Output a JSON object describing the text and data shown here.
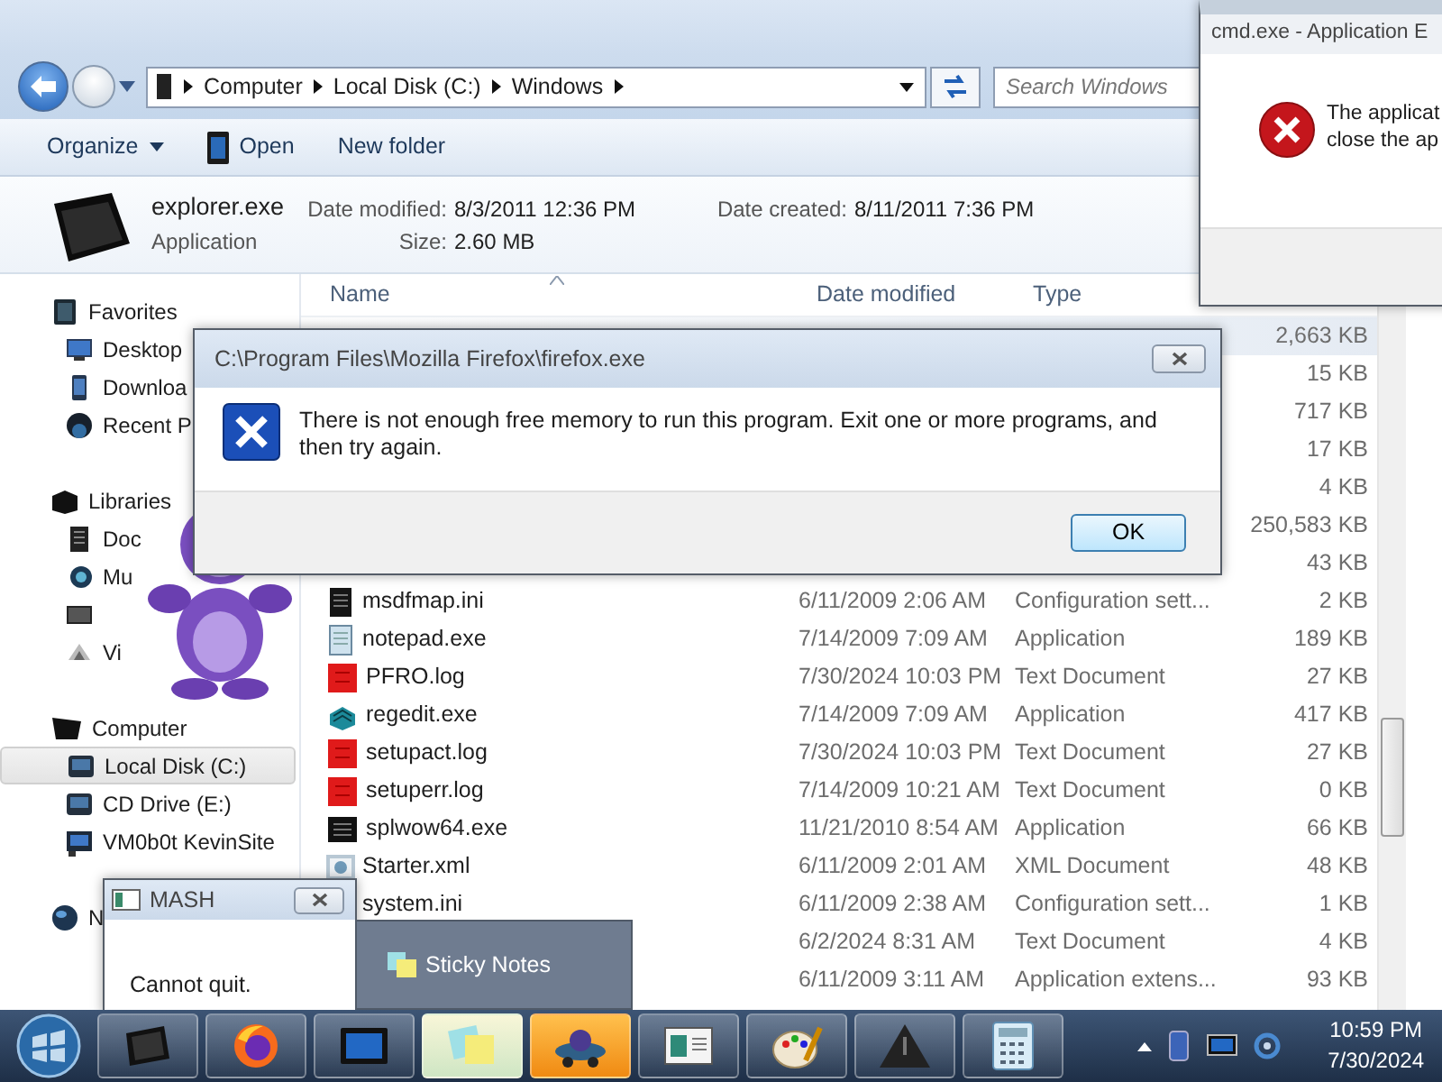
{
  "explorer": {
    "address": {
      "crumbs": [
        "Computer",
        "Local Disk (C:)",
        "Windows"
      ]
    },
    "search": {
      "placeholder": "Search Windows"
    },
    "toolbar": [
      {
        "label": "Organize",
        "kind": "menu"
      },
      {
        "label": "Open",
        "kind": "open"
      },
      {
        "label": "New folder",
        "kind": "plain"
      }
    ],
    "details": {
      "name": "explorer.exe",
      "type": "Application",
      "date_modified": {
        "label": "Date modified:",
        "value": "8/3/2011 12:36 PM"
      },
      "size": {
        "label": "Size:",
        "value": "2.60 MB"
      },
      "date_created": {
        "label": "Date created:",
        "value": "8/11/2011 7:36 PM"
      }
    },
    "sidebar": [
      {
        "label": "Favorites",
        "kind": "favorites",
        "selected": false,
        "children": [
          {
            "label": "Desktop",
            "kind": "desktop",
            "selected": false
          },
          {
            "label": "Downloa",
            "kind": "downloads",
            "selected": false
          },
          {
            "label": "Recent P",
            "kind": "recent",
            "selected": false
          }
        ]
      },
      {
        "label": "Libraries",
        "kind": "libraries",
        "selected": false,
        "children": [
          {
            "label": "Doc",
            "kind": "documents",
            "selected": false
          },
          {
            "label": "Mu",
            "kind": "music",
            "selected": false
          },
          {
            "kind": "pictures",
            "selected": false
          },
          {
            "label": "Vi",
            "kind": "videos",
            "selected": false
          }
        ]
      },
      {
        "label": "Computer",
        "kind": "computer",
        "selected": false,
        "children": [
          {
            "label": "Local Disk (C:)",
            "kind": "drive",
            "selected": true
          },
          {
            "label": "CD Drive (E:)",
            "kind": "cd",
            "selected": false
          },
          {
            "label": "VM0b0t KevinSite",
            "kind": "netdrive",
            "selected": false
          }
        ]
      },
      {
        "label": "N",
        "kind": "network",
        "selected": false
      }
    ],
    "columns": [
      "Name",
      "Date modified",
      "Type"
    ],
    "rows": [
      {
        "size": "2,663 KB",
        "selected": true
      },
      {
        "size": "15 KB",
        "selected": false
      },
      {
        "size": "717 KB",
        "selected": false
      },
      {
        "size": "17 KB",
        "selected": false
      },
      {
        "size": "4 KB",
        "selected": false
      },
      {
        "size": "250,583 KB",
        "selected": false
      },
      {
        "size": "43 KB",
        "selected": false
      },
      {
        "name": "msdfmap.ini",
        "kind": "ini",
        "date": "6/11/2009 2:06 AM",
        "type": "Configuration sett...",
        "size": "2 KB",
        "selected": false
      },
      {
        "name": "notepad.exe",
        "kind": "notepad",
        "date": "7/14/2009 7:09 AM",
        "type": "Application",
        "size": "189 KB",
        "selected": false
      },
      {
        "name": "PFRO.log",
        "kind": "log",
        "date": "7/30/2024 10:03 PM",
        "type": "Text Document",
        "size": "27 KB",
        "selected": false
      },
      {
        "name": "regedit.exe",
        "kind": "regedit",
        "date": "7/14/2009 7:09 AM",
        "type": "Application",
        "size": "417 KB",
        "selected": false
      },
      {
        "name": "setupact.log",
        "kind": "log",
        "date": "7/30/2024 10:03 PM",
        "type": "Text Document",
        "size": "27 KB",
        "selected": false
      },
      {
        "name": "setuperr.log",
        "kind": "log",
        "date": "7/14/2009 10:21 AM",
        "type": "Text Document",
        "size": "0 KB",
        "selected": false
      },
      {
        "name": "splwow64.exe",
        "kind": "exe",
        "date": "11/21/2010 8:54 AM",
        "type": "Application",
        "size": "66 KB",
        "selected": false
      },
      {
        "name": "Starter.xml",
        "kind": "xml",
        "date": "6/11/2009 2:01 AM",
        "type": "XML Document",
        "size": "48 KB",
        "selected": false
      },
      {
        "name": "system.ini",
        "date": "6/11/2009 2:38 AM",
        "type": "Configuration sett...",
        "size": "1 KB",
        "selected": false
      },
      {
        "date": "6/2/2024 8:31 AM",
        "type": "Text Document",
        "size": "4 KB",
        "selected": false
      },
      {
        "date": "6/11/2009 3:11 AM",
        "type": "Application extens...",
        "size": "93 KB",
        "selected": false
      }
    ]
  },
  "cmd_dialog": {
    "title": "cmd.exe - Application E",
    "lines": [
      "The applicat",
      "close the ap"
    ]
  },
  "firefox_dialog": {
    "title": "C:\\Program Files\\Mozilla Firefox\\firefox.exe",
    "message": "There is not enough free memory to run this program. Exit one or more programs, and then try again.",
    "button": "OK"
  },
  "mash_dialog": {
    "title": "MASH",
    "message": "Cannot quit."
  },
  "sticky_preview": {
    "label": "Sticky Notes"
  },
  "taskbar": {
    "items": [
      {
        "kind": "explorer",
        "hovered": false,
        "flashing": false
      },
      {
        "kind": "firefox",
        "hovered": false,
        "flashing": false
      },
      {
        "kind": "screen",
        "hovered": false,
        "flashing": false
      },
      {
        "kind": "sticky",
        "hovered": true,
        "flashing": false
      },
      {
        "kind": "bonzi",
        "hovered": false,
        "flashing": true
      },
      {
        "kind": "window",
        "hovered": false,
        "flashing": false
      },
      {
        "kind": "paint",
        "hovered": false,
        "flashing": false
      },
      {
        "kind": "warning",
        "hovered": false,
        "flashing": false
      },
      {
        "kind": "calculator",
        "hovered": false,
        "flashing": false
      }
    ],
    "clock": {
      "time": "10:59 PM",
      "date": "7/30/2024"
    }
  }
}
